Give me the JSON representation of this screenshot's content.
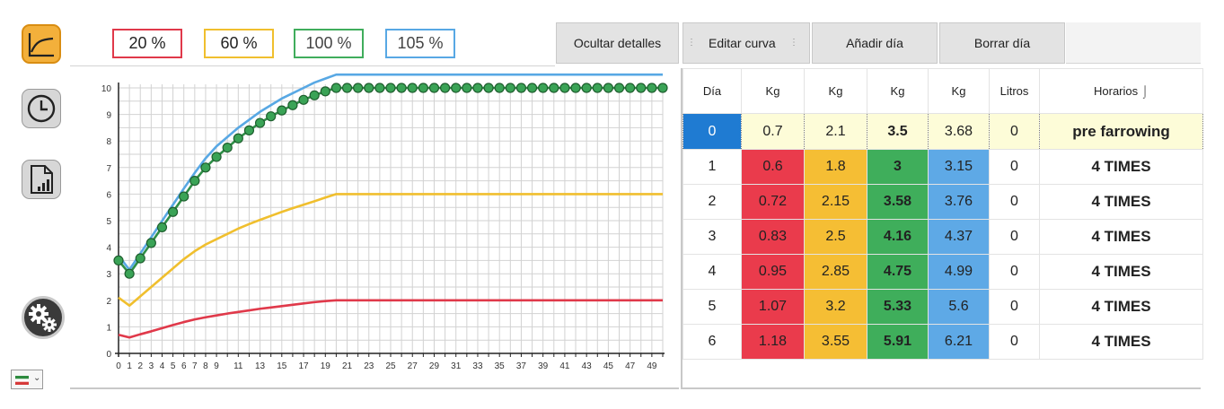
{
  "sidebar": {
    "items": [
      {
        "id": "curve",
        "icon": "growth-curve-icon"
      },
      {
        "id": "schedule",
        "icon": "clock-icon"
      },
      {
        "id": "report",
        "icon": "report-chart-icon"
      },
      {
        "id": "settings",
        "icon": "gears-icon"
      }
    ],
    "language_flag": "flag-icon"
  },
  "legend": {
    "items": [
      {
        "label": "20  %",
        "color": "#e0394a"
      },
      {
        "label": "60  %",
        "color": "#f0bf2e"
      },
      {
        "label": "100  %",
        "color": "#40ad5c"
      },
      {
        "label": "105  %",
        "color": "#58a8e4"
      }
    ]
  },
  "toolbar": {
    "hide_details": "Ocultar detalles",
    "edit_curve": "Editar curva",
    "add_day": "Añadir día",
    "delete_day": "Borrar día"
  },
  "table": {
    "headers": [
      "Día",
      "Kg",
      "Kg",
      "Kg",
      "Kg",
      "Litros",
      "Horarios"
    ],
    "sort_mark": "⌡",
    "rows": [
      [
        "0",
        "0.7",
        "2.1",
        "3.5",
        "3.68",
        "0",
        "pre farrowing"
      ],
      [
        "1",
        "0.6",
        "1.8",
        "3",
        "3.15",
        "0",
        "4 TIMES"
      ],
      [
        "2",
        "0.72",
        "2.15",
        "3.58",
        "3.76",
        "0",
        "4 TIMES"
      ],
      [
        "3",
        "0.83",
        "2.5",
        "4.16",
        "4.37",
        "0",
        "4 TIMES"
      ],
      [
        "4",
        "0.95",
        "2.85",
        "4.75",
        "4.99",
        "0",
        "4 TIMES"
      ],
      [
        "5",
        "1.07",
        "3.2",
        "5.33",
        "5.6",
        "0",
        "4 TIMES"
      ],
      [
        "6",
        "1.18",
        "3.55",
        "5.91",
        "6.21",
        "0",
        "4 TIMES"
      ]
    ]
  },
  "chart_data": {
    "type": "line",
    "xlim": [
      0,
      50
    ],
    "ylim": [
      0,
      10
    ],
    "x_ticks": [
      "0",
      "1",
      "2",
      "3",
      "4",
      "5",
      "6",
      "7",
      "8",
      "9",
      "11",
      "13",
      "15",
      "17",
      "19",
      "21",
      "23",
      "25",
      "27",
      "29",
      "31",
      "33",
      "35",
      "37",
      "39",
      "41",
      "43",
      "45",
      "47",
      "49"
    ],
    "y_ticks": [
      "0",
      "1",
      "2",
      "3",
      "4",
      "5",
      "6",
      "7",
      "8",
      "9",
      "10"
    ],
    "grid": true,
    "legend": "top",
    "series": [
      {
        "name": "20 %",
        "color": "#e0394a",
        "marker": "none",
        "x": [
          0,
          1,
          2,
          3,
          4,
          5,
          6,
          7,
          8,
          9,
          10,
          11,
          12,
          13,
          14,
          15,
          16,
          17,
          18,
          19,
          20,
          50
        ],
        "values": [
          0.7,
          0.6,
          0.72,
          0.83,
          0.95,
          1.07,
          1.18,
          1.28,
          1.36,
          1.43,
          1.5,
          1.56,
          1.62,
          1.68,
          1.73,
          1.78,
          1.83,
          1.88,
          1.93,
          1.97,
          2.0,
          2.0
        ]
      },
      {
        "name": "60 %",
        "color": "#f0bf2e",
        "marker": "none",
        "x": [
          0,
          1,
          2,
          3,
          4,
          5,
          6,
          7,
          8,
          9,
          10,
          11,
          12,
          13,
          14,
          15,
          16,
          17,
          18,
          19,
          20,
          50
        ],
        "values": [
          2.1,
          1.8,
          2.15,
          2.5,
          2.85,
          3.2,
          3.55,
          3.85,
          4.1,
          4.3,
          4.5,
          4.7,
          4.87,
          5.03,
          5.18,
          5.33,
          5.47,
          5.6,
          5.73,
          5.87,
          6.0,
          6.0
        ]
      },
      {
        "name": "100 %",
        "color": "#2f8f47",
        "marker": "circle",
        "x": [
          0,
          1,
          2,
          3,
          4,
          5,
          6,
          7,
          8,
          9,
          10,
          11,
          12,
          13,
          14,
          15,
          16,
          17,
          18,
          19,
          20,
          21,
          22,
          23,
          24,
          25,
          26,
          27,
          28,
          29,
          30,
          31,
          32,
          33,
          34,
          35,
          36,
          37,
          38,
          39,
          40,
          41,
          42,
          43,
          44,
          45,
          46,
          47,
          48,
          49,
          50
        ],
        "values": [
          3.5,
          3.0,
          3.58,
          4.16,
          4.75,
          5.33,
          5.91,
          6.5,
          7.0,
          7.4,
          7.75,
          8.1,
          8.4,
          8.68,
          8.93,
          9.15,
          9.35,
          9.55,
          9.72,
          9.87,
          10,
          10,
          10,
          10,
          10,
          10,
          10,
          10,
          10,
          10,
          10,
          10,
          10,
          10,
          10,
          10,
          10,
          10,
          10,
          10,
          10,
          10,
          10,
          10,
          10,
          10,
          10,
          10,
          10,
          10,
          10
        ]
      },
      {
        "name": "105 %",
        "color": "#58a8e4",
        "marker": "none",
        "x": [
          0,
          1,
          2,
          3,
          4,
          5,
          6,
          7,
          8,
          9,
          10,
          11,
          12,
          13,
          14,
          15,
          16,
          17,
          18,
          19,
          20,
          50
        ],
        "values": [
          3.68,
          3.15,
          3.76,
          4.37,
          4.99,
          5.6,
          6.21,
          6.8,
          7.35,
          7.8,
          8.15,
          8.5,
          8.8,
          9.1,
          9.35,
          9.6,
          9.8,
          10.0,
          10.2,
          10.35,
          10.5,
          10.5
        ]
      }
    ]
  }
}
